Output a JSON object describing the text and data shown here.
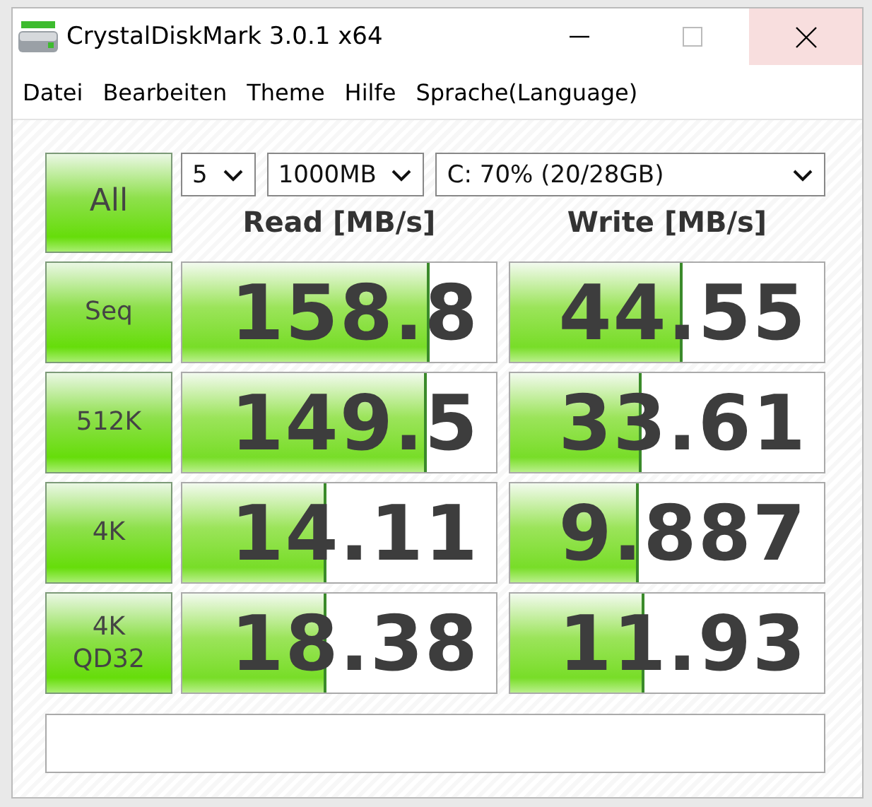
{
  "window": {
    "title": "CrystalDiskMark 3.0.1 x64"
  },
  "menu": [
    "Datei",
    "Bearbeiten",
    "Theme",
    "Hilfe",
    "Sprache(Language)"
  ],
  "all_button": "All",
  "selects": [
    {
      "value": "5"
    },
    {
      "value": "1000MB"
    },
    {
      "value": "C: 70% (20/28GB)"
    }
  ],
  "columns": [
    "Read [MB/s]",
    "Write [MB/s]"
  ],
  "rows": [
    {
      "label": "Seq",
      "read": {
        "value": "158.8",
        "level": 0.78
      },
      "write": {
        "value": "44.55",
        "level": 0.54
      }
    },
    {
      "label": "512K",
      "read": {
        "value": "149.5",
        "level": 0.77
      },
      "write": {
        "value": "33.61",
        "level": 0.41
      }
    },
    {
      "label": "4K",
      "read": {
        "value": "14.11",
        "level": 0.45
      },
      "write": {
        "value": "9.887",
        "level": 0.4
      }
    },
    {
      "label": "4K\nQD32",
      "read": {
        "value": "18.38",
        "level": 0.45
      },
      "write": {
        "value": "11.93",
        "level": 0.42
      }
    }
  ]
}
